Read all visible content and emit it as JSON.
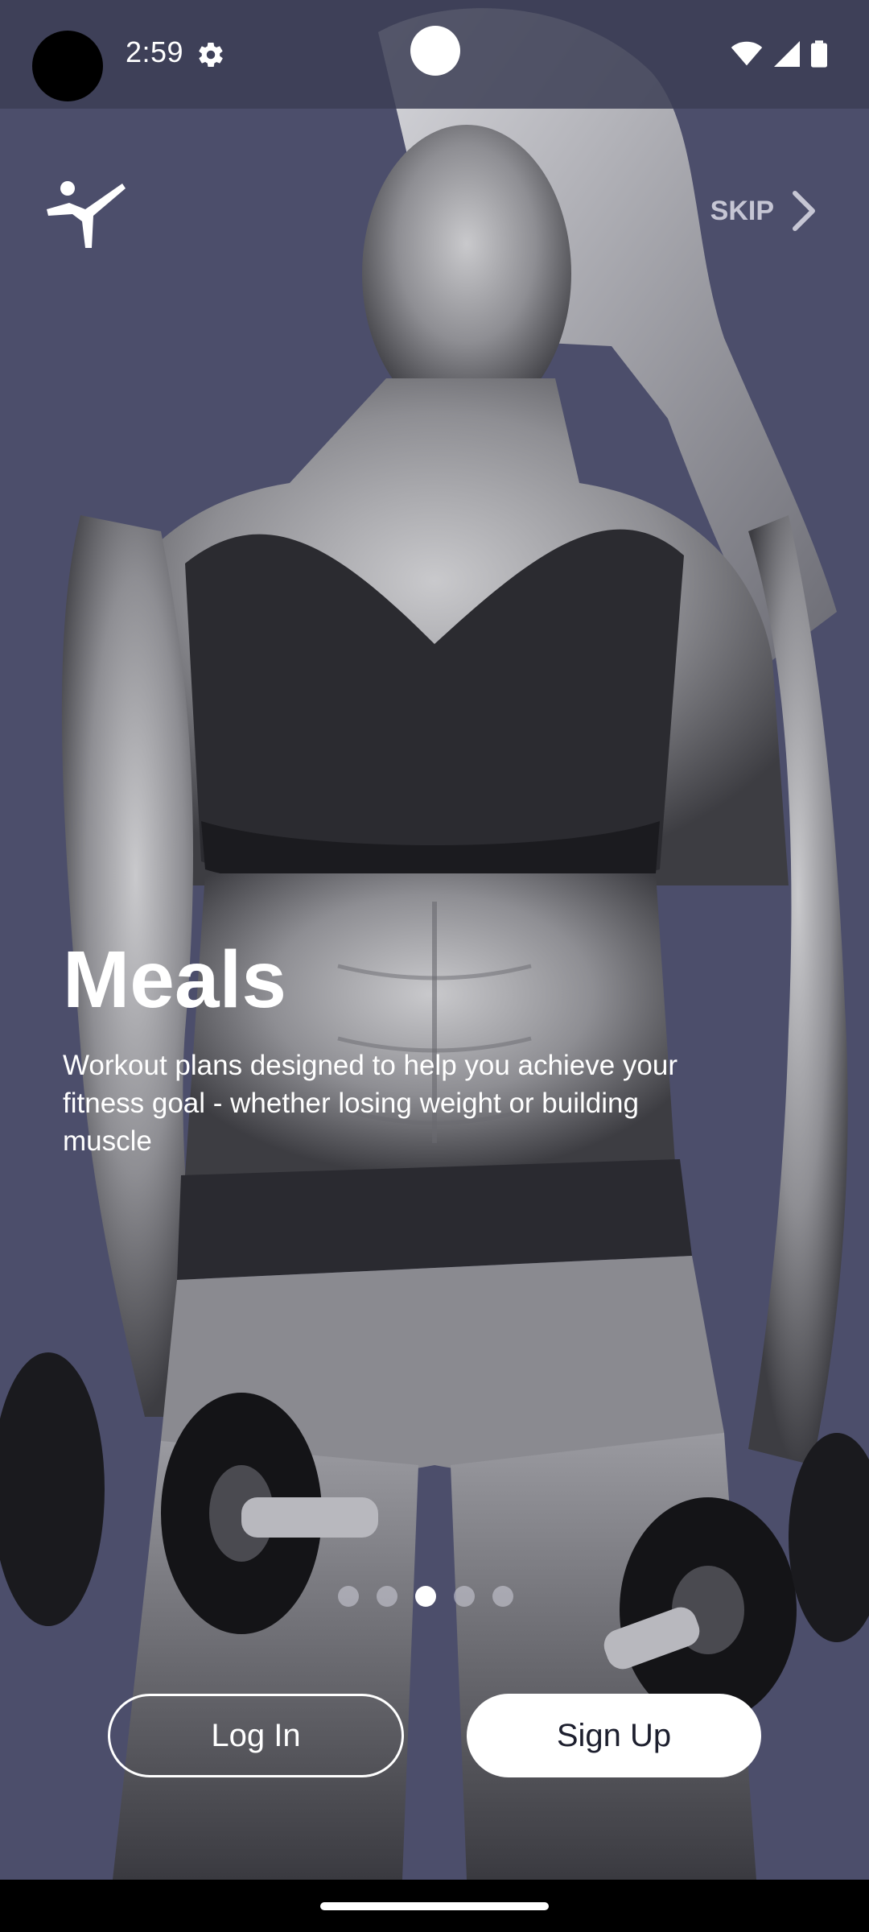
{
  "status_bar": {
    "time": "2:59",
    "icons": [
      "settings-gear-icon",
      "wifi-icon",
      "signal-icon",
      "battery-icon"
    ]
  },
  "header": {
    "logo": "martial-arts-kick-icon",
    "skip_label": "SKIP",
    "skip_icon": "chevron-right-icon"
  },
  "slide": {
    "title": "Meals",
    "description": "Workout plans designed to help you achieve your fitness goal - whether losing weight or building muscle"
  },
  "pager": {
    "total": 5,
    "active_index": 2
  },
  "actions": {
    "login_label": "Log In",
    "signup_label": "Sign Up"
  },
  "colors": {
    "background": "#4c4e6b",
    "primary_text": "#ffffff",
    "button_text_dark": "#1d1f2e"
  }
}
